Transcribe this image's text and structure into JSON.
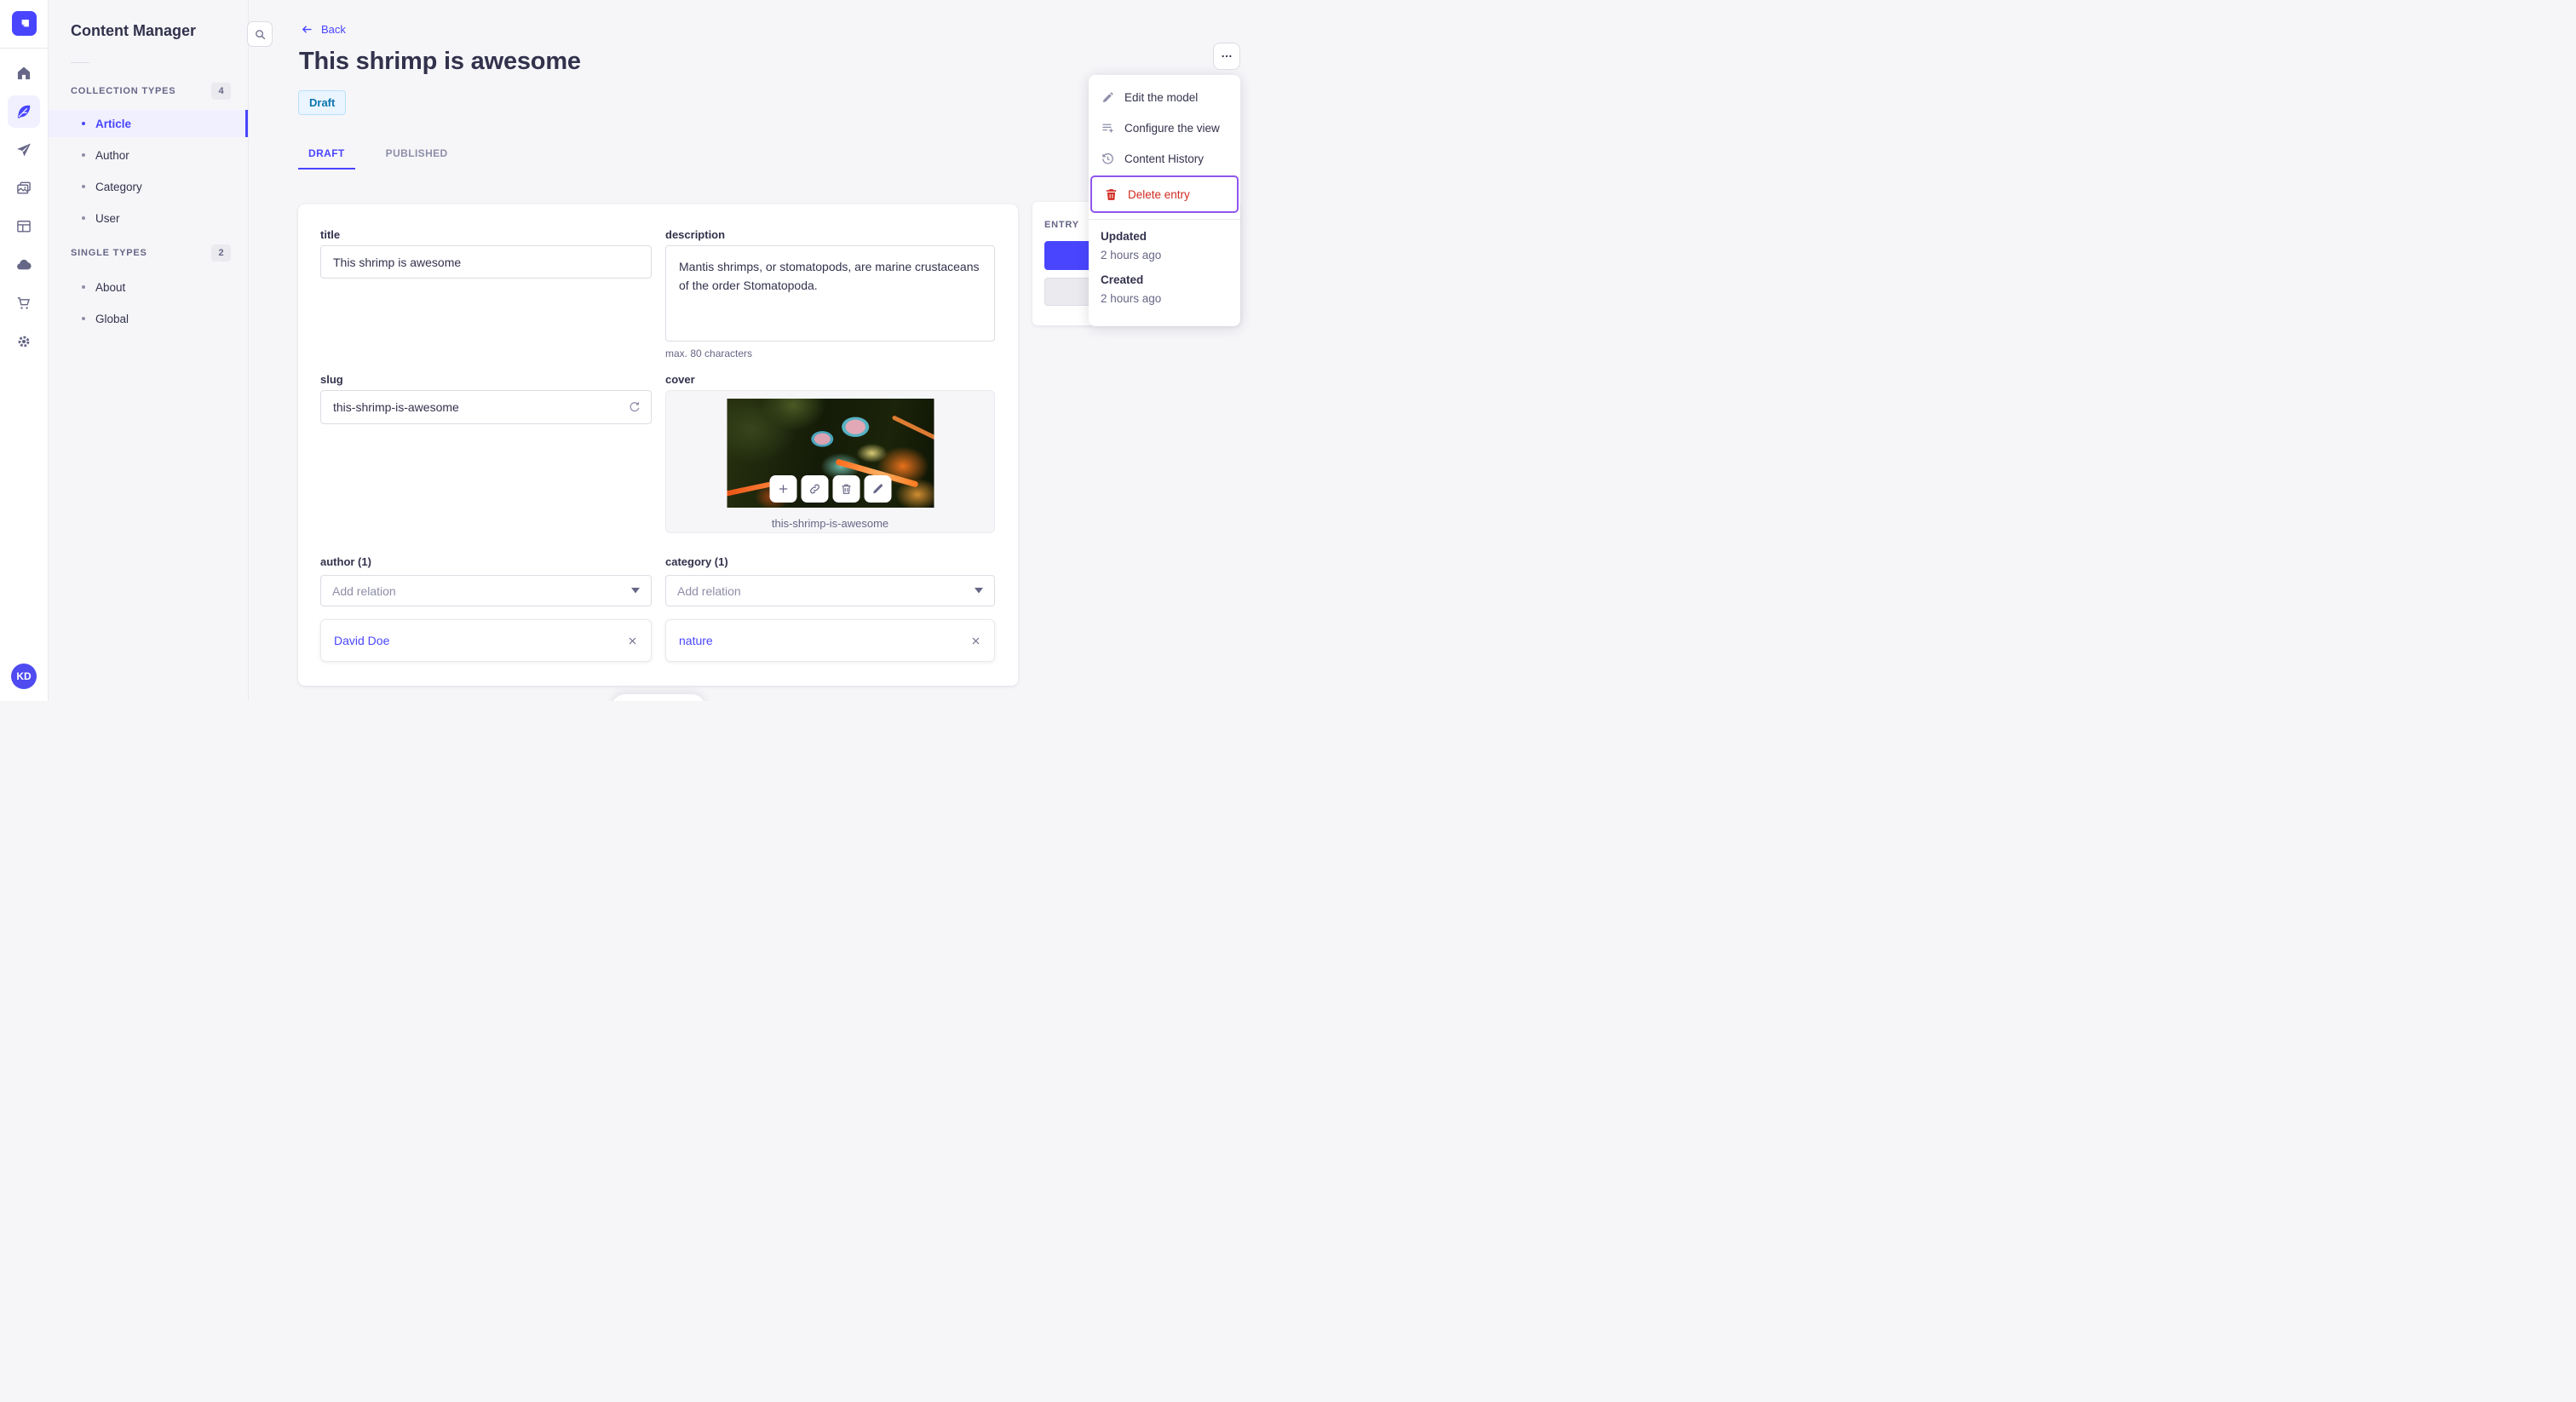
{
  "colors": {
    "primary": "#4945ff",
    "primary_light": "#f0f0ff",
    "danger": "#d02b20",
    "focus_ring": "#9056ed",
    "draft_bg": "#eaf5ff",
    "draft_border": "#b8e1ff",
    "draft_text": "#0c75af",
    "text_dark": "#32324d",
    "text_gray": "#666687"
  },
  "nav": {
    "logo_icon": "strapi-logo",
    "items": [
      {
        "icon": "home-icon"
      },
      {
        "icon": "feather-icon",
        "active": true
      },
      {
        "icon": "paper-plane-icon"
      },
      {
        "icon": "media-icon"
      },
      {
        "icon": "layout-icon"
      },
      {
        "icon": "cloud-icon"
      },
      {
        "icon": "cart-icon"
      },
      {
        "icon": "gear-icon"
      }
    ],
    "user_initials": "KD"
  },
  "subnav": {
    "title": "Content Manager",
    "search_icon": "search-icon",
    "sections": [
      {
        "label": "COLLECTION TYPES",
        "count": "4",
        "items": [
          {
            "label": "Article",
            "active": true
          },
          {
            "label": "Author"
          },
          {
            "label": "Category"
          },
          {
            "label": "User"
          }
        ]
      },
      {
        "label": "SINGLE TYPES",
        "count": "2",
        "items": [
          {
            "label": "About"
          },
          {
            "label": "Global"
          }
        ]
      }
    ]
  },
  "header": {
    "back": "Back",
    "title": "This shrimp is awesome",
    "status": "Draft",
    "tabs": [
      {
        "label": "DRAFT",
        "active": true
      },
      {
        "label": "PUBLISHED"
      }
    ]
  },
  "form": {
    "title": {
      "label": "title",
      "value": "This shrimp is awesome"
    },
    "description": {
      "label": "description",
      "value": "Mantis shrimps, or stomatopods, are marine crustaceans of the order Stomatopoda.",
      "hint": "max. 80 characters"
    },
    "slug": {
      "label": "slug",
      "value": "this-shrimp-is-awesome",
      "icon": "refresh-icon"
    },
    "cover": {
      "label": "cover",
      "caption": "this-shrimp-is-awesome",
      "actions": [
        {
          "icon": "plus-icon"
        },
        {
          "icon": "link-icon"
        },
        {
          "icon": "trash-icon"
        },
        {
          "icon": "pencil-icon"
        }
      ]
    },
    "author": {
      "label": "author (1)",
      "placeholder": "Add relation",
      "relation": "David Doe"
    },
    "category": {
      "label": "category (1)",
      "placeholder": "Add relation",
      "relation": "nature"
    }
  },
  "entry_panel": {
    "title": "ENTRY"
  },
  "more_button": {
    "icon": "ellipsis-icon"
  },
  "context_menu": {
    "items": [
      {
        "label": "Edit the model",
        "icon": "pencil-icon"
      },
      {
        "label": "Configure the view",
        "icon": "list-plus-icon"
      },
      {
        "label": "Content History",
        "icon": "history-icon"
      },
      {
        "label": "Delete entry",
        "icon": "trash-icon",
        "danger": true
      }
    ],
    "meta": [
      {
        "label": "Updated",
        "value": "2 hours ago"
      },
      {
        "label": "Created",
        "value": "2 hours ago"
      }
    ]
  }
}
